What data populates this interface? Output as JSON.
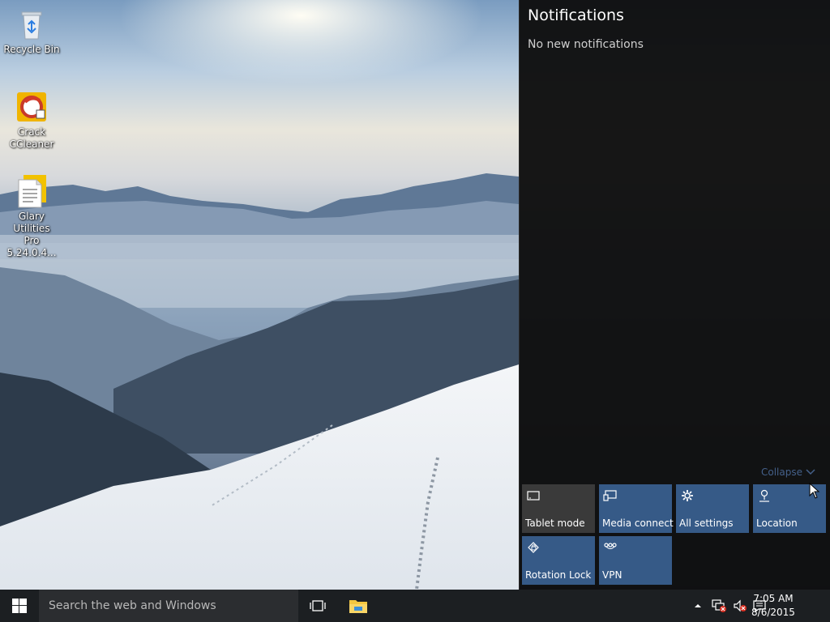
{
  "desktop": {
    "icons": [
      {
        "label": "Recycle Bin",
        "icon": "recycle-bin-icon"
      },
      {
        "label": "Crack\nCCleaner",
        "icon": "ccleaner-icon"
      },
      {
        "label": "Glary Utilities\nPro 5.24.0.4...",
        "icon": "document-shortcut-icon"
      }
    ]
  },
  "action_center": {
    "title": "Notifications",
    "empty_text": "No new notifications",
    "collapse_label": "Collapse",
    "tiles": [
      {
        "label": "Tablet mode",
        "icon": "tablet-mode-icon",
        "state": "off"
      },
      {
        "label": "Media connect",
        "icon": "media-connect-icon",
        "state": "on"
      },
      {
        "label": "All settings",
        "icon": "gear-icon",
        "state": "on"
      },
      {
        "label": "Location",
        "icon": "location-icon",
        "state": "on"
      },
      {
        "label": "Rotation Lock",
        "icon": "rotation-lock-icon",
        "state": "on"
      },
      {
        "label": "VPN",
        "icon": "vpn-icon",
        "state": "on"
      }
    ]
  },
  "taskbar": {
    "search_placeholder": "Search the web and Windows",
    "clock": {
      "time": "7:05 AM",
      "date": "8/6/2015"
    }
  },
  "colors": {
    "tile_on": "#365a87",
    "tile_off": "#3a3a3a",
    "taskbar": "#1c1f22",
    "panel": "#0e0e0e"
  }
}
